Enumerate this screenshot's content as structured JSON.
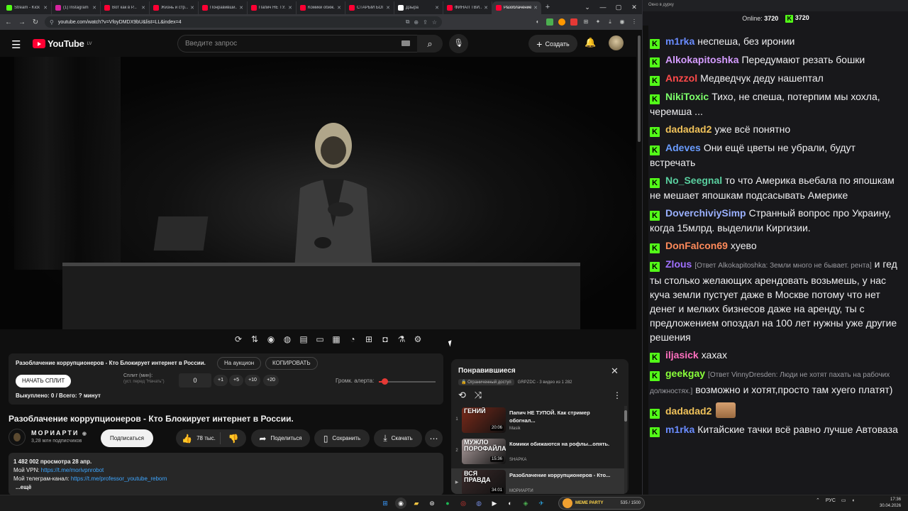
{
  "browser": {
    "tabs": [
      {
        "label": "Stream - Kick",
        "fav": "#53fc18"
      },
      {
        "label": "(1) Instagram",
        "fav": "#d6249f"
      },
      {
        "label": "Вот как в Р...",
        "fav": "#ff0033"
      },
      {
        "label": "Жизнь и стр...",
        "fav": "#ff0033"
      },
      {
        "label": "Понравивши...",
        "fav": "#ff0033"
      },
      {
        "label": "Папич НЕ ТУ...",
        "fav": "#ff0033"
      },
      {
        "label": "Комики обиж...",
        "fav": "#ff0033"
      },
      {
        "label": "СТАРЫЙ БОГ...",
        "fav": "#ff0033"
      },
      {
        "label": "Дзыра",
        "fav": "#ffffff"
      },
      {
        "label": "ФИНАЛ ТВИ...",
        "fav": "#ff0033"
      },
      {
        "label": "Разоблачение...",
        "fav": "#ff0033",
        "active": true
      }
    ],
    "url": "youtube.com/watch?v=VfoyDMDX9bU&list=LL&index=4"
  },
  "youtube": {
    "logo_text": "YouTube",
    "logo_region": "LV",
    "search_placeholder": "Введите запрос",
    "create_label": "Создать"
  },
  "auction": {
    "title": "Разоблачение коррупционеров - Кто Блокирует интернет в России.",
    "on_auction_label": "На аукцион",
    "copy_label": "КОПИРОВАТЬ",
    "start_label": "НАЧАТЬ СПЛИТ",
    "split_label": "Сплит (мин):",
    "split_hint": "(уст. перед \"Начать\")",
    "split_value": "0",
    "increments": [
      "+1",
      "+5",
      "+10",
      "+20"
    ],
    "volume_label": "Громк. алерта:",
    "volume_level": 0.1,
    "bought_text": "Выкуплено: 0 / Всего: ? минут"
  },
  "video": {
    "title": "Разоблачение коррупционеров - Кто Блокирует интернет в России.",
    "channel": "МОРИАРТИ",
    "subscribers": "3,28 млн подписчиков",
    "subscribe_label": "Подписаться",
    "likes": "78 тыс.",
    "share_label": "Поделиться",
    "save_label": "Сохранить",
    "download_label": "Скачать",
    "views_date": "1 482 002 просмотра  28 апр.",
    "vpn_label": "Мой VPN: ",
    "vpn_link": "https://t.me/morivpnrobot",
    "tg_label": "Мой телеграм-канал: ",
    "tg_link": "https://t.me/professor_youtube_reborn",
    "more_label": "...ещё"
  },
  "playlist": {
    "title": "Понравившиеся",
    "access": "Ограниченный доступ",
    "meta": "GRPZDC - 3 видео из 1 282",
    "items": [
      {
        "idx": "1",
        "caption": "ГЕНИЙ",
        "title": "Папич НЕ ТУПОЙ. Как стример обогнал...",
        "channel": "Masik",
        "duration": "20:06",
        "thumb": "#7a2a1a"
      },
      {
        "idx": "2",
        "caption": "МУЖЛО ПОРОФАЙЛА",
        "title": "Комики обижаются на рофлы...опять.",
        "channel": "SHAPKA",
        "duration": "15:36",
        "thumb": "#b0a0a0"
      },
      {
        "idx": "▶",
        "caption": "ВСЯ ПРАВДА",
        "title": "Разоблачение коррупционеров - Кто...",
        "channel": "МОРИАРТИ",
        "duration": "34:01",
        "thumb": "#3a2a2a",
        "active": true
      }
    ]
  },
  "chat": {
    "window_title": "Окно в дурку",
    "online_label": "Online:",
    "online_count": "3720",
    "kick_count": "3720",
    "messages": [
      {
        "user": "m1rka",
        "color": "#6a8cff",
        "text": "неспеша, без иронии"
      },
      {
        "user": "Alkokapitoshka",
        "color": "#d59cff",
        "text": "Передумают резать бошки"
      },
      {
        "user": "Anzzol",
        "color": "#ff4a4a",
        "text": "Медведчук деду нашептал"
      },
      {
        "user": "NikiToxic",
        "color": "#7cff6a",
        "text": "Тихо, не спеша, потерпим мы хохла, черемша ..."
      },
      {
        "user": "dadadad2",
        "color": "#f0c25a",
        "text": "уже всё понятно"
      },
      {
        "user": "Adeves",
        "color": "#6a9cff",
        "text": "Они ещё цветы не убрали, будут встречать"
      },
      {
        "user": "No_Seegnal",
        "color": "#5ad0a0",
        "text": "то что Америка вьебала по япошкам не мешает япошкам подсасывать Америке"
      },
      {
        "user": "DoverchiviySimp",
        "color": "#9ab0ff",
        "text": "Странный вопрос про Украину, когда 15млрд. выделили Киргизии."
      },
      {
        "user": "DonFalcon69",
        "color": "#ff8a5a",
        "text": "хуево"
      },
      {
        "user": "Zlous",
        "color": "#a070ff",
        "reply": "[Ответ Alkokapitoshka: Земли много не бывает. рента]",
        "text": "и гед ты столько желающих арендовать возьмешь, у нас куча земли пустует даже в Москве потому что нет денег и мелких бизнесов даже на аренду, ты с предложением опоздал на 100 лет нужны уже другие решения"
      },
      {
        "user": "iljasick",
        "color": "#ff70c0",
        "text": "хахах"
      },
      {
        "user": "geekgay",
        "color": "#8aff3a",
        "reply": "[Ответ VinnyDresden: Люди не хотят пахать на рабочих должностях.]",
        "text": "возможно и хотят,просто там хуего платят)"
      },
      {
        "user": "dadadad2",
        "color": "#f0c25a",
        "text": "",
        "emote": true
      },
      {
        "user": "m1rka",
        "color": "#6a8cff",
        "text": "Китайские тачки всё равно лучше Автоваза"
      }
    ]
  },
  "taskbar": {
    "meme_label": "MEME PARTY",
    "meme_count": "535 / 1500",
    "lang": "РУС",
    "time": "17:36",
    "date": "30.04.2026"
  }
}
